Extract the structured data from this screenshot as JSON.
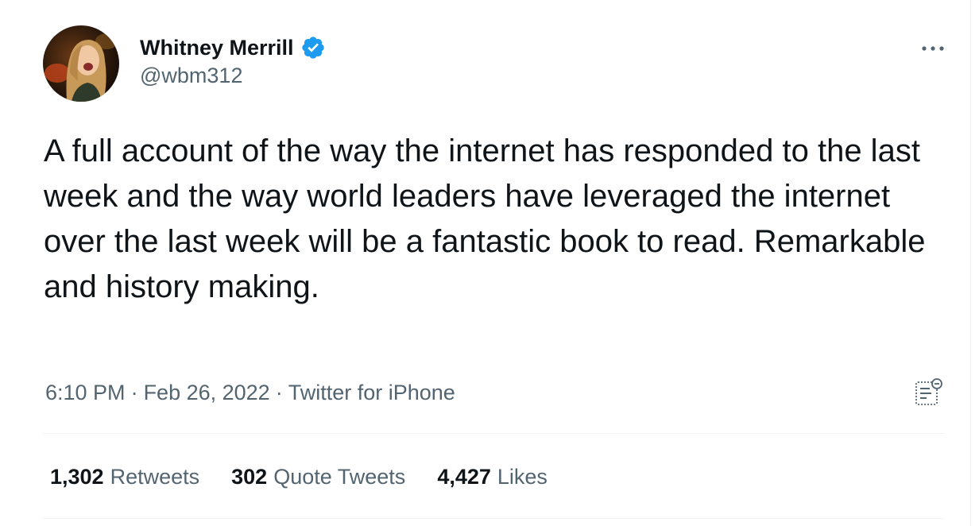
{
  "tweet": {
    "author": {
      "display_name": "Whitney Merrill",
      "handle": "@wbm312",
      "verified": true,
      "avatar_icon": "profile-photo"
    },
    "text": "A full account of the way the internet has responded to the last week and the way world leaders have leveraged the internet over the last week will be a fantastic book to read. Remarkable and history making.",
    "time": "6:10 PM",
    "date": "Feb 26, 2022",
    "separator": "·",
    "source": "Twitter for iPhone",
    "stats": {
      "retweets_count": "1,302",
      "retweets_label": "Retweets",
      "quote_tweets_count": "302",
      "quote_tweets_label": "Quote Tweets",
      "likes_count": "4,427",
      "likes_label": "Likes"
    }
  },
  "icons": {
    "more": "more-horizontal-icon",
    "verified": "verified-badge-icon",
    "activity": "tweet-analytics-icon"
  },
  "colors": {
    "primary_text": "#0f1419",
    "secondary_text": "#536471",
    "verified_blue": "#1d9bf0",
    "divider": "#eff3f4"
  }
}
